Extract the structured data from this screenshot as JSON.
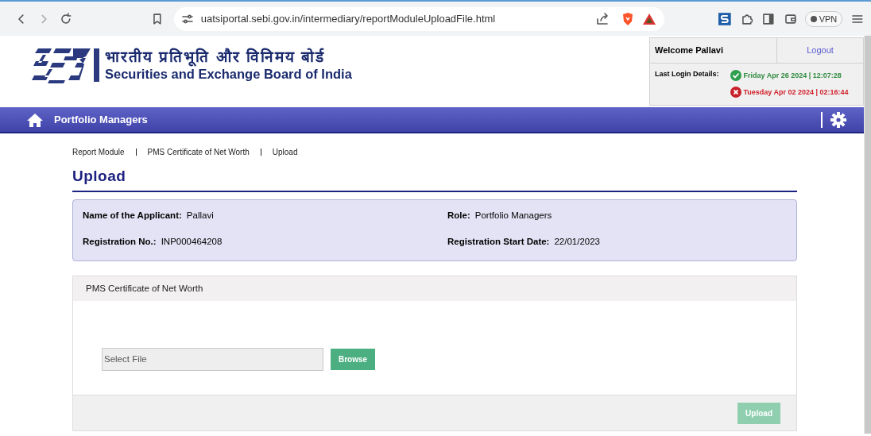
{
  "browser": {
    "url": "uatsiportal.sebi.gov.in/intermediary/reportModuleUploadFile.html",
    "vpn_label": "VPN"
  },
  "header": {
    "logo_hindi": "भारतीय प्रतिभूति और विनिमय बोर्ड",
    "logo_english": "Securities and Exchange Board of India",
    "welcome": "Welcome Pallavi",
    "logout": "Logout",
    "last_login_label": "Last Login Details:",
    "logins": [
      {
        "kind": "success",
        "text": "Friday Apr 26 2024 | 12:07:28"
      },
      {
        "kind": "failure",
        "text": "Tuesday Apr 02 2024 | 02:16:44"
      }
    ]
  },
  "nav": {
    "title": "Portfolio Managers"
  },
  "breadcrumb": [
    {
      "label": "Report Module"
    },
    {
      "label": "PMS Certificate of Net Worth"
    },
    {
      "label": "Upload"
    }
  ],
  "page_title": "Upload",
  "applicant": [
    {
      "label": "Name of the Applicant:",
      "value": "Pallavi"
    },
    {
      "label": "Role:",
      "value": "Portfolio Managers"
    },
    {
      "label": "Registration No.:",
      "value": "INP000464208"
    },
    {
      "label": "Registration Start Date:",
      "value": "22/01/2023"
    }
  ],
  "panel": {
    "title": "PMS Certificate of Net Worth",
    "file_placeholder": "Select File",
    "browse": "Browse",
    "upload": {
      "label": "Upload",
      "disabled": true
    }
  }
}
